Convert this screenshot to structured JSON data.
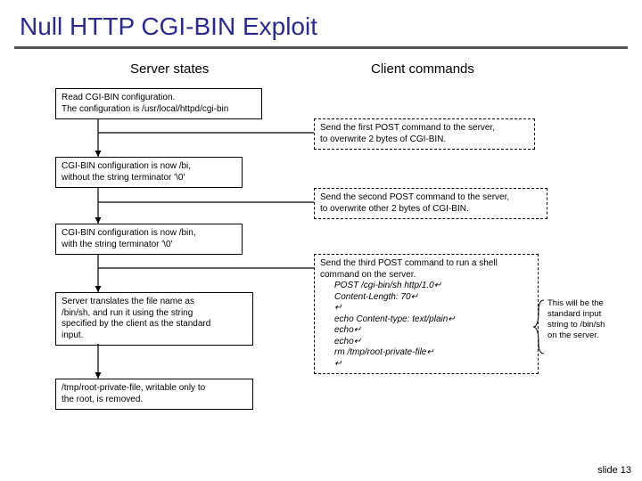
{
  "title": "Null HTTP CGI-BIN Exploit",
  "headers": {
    "left": "Server states",
    "right": "Client commands"
  },
  "server": {
    "s1a": "Read CGI-BIN configuration.",
    "s1b": "The configuration is /usr/local/httpd/cgi-bin",
    "s2a": "CGI-BIN configuration is now /bi,",
    "s2b": "without the string terminator '\\0'",
    "s3a": "CGI-BIN configuration is now /bin,",
    "s3b": "with the string terminator '\\0'",
    "s4a": "Server translates the file name as",
    "s4b": "/bin/sh, and run it using the string",
    "s4c": "specified by the client as the standard",
    "s4d": "input.",
    "s5a": "/tmp/root-private-file, writable only to",
    "s5b": "the root, is removed."
  },
  "client": {
    "c1a": "Send the first POST command to the server,",
    "c1b": "to overwrite 2 bytes of CGI-BIN.",
    "c2a": "Send the second POST command to the server,",
    "c2b": "to overwrite other 2 bytes of CGI-BIN.",
    "c3a": "Send the third POST command to run a shell",
    "c3b": "command on the server.",
    "c3c": "POST /cgi-bin/sh http/1.0↵",
    "c3d": "Content-Length: 70↵",
    "c3e": "↵",
    "c3f": "echo Content-type: text/plain↵",
    "c3g": "echo↵",
    "c3h": "echo↵",
    "c3i": "rm /tmp/root-private-file↵",
    "c3j": "↵"
  },
  "note": {
    "n1": "This will be the",
    "n2": "standard input",
    "n3": "string to /bin/sh",
    "n4": "on the server."
  },
  "footer": "slide 13"
}
